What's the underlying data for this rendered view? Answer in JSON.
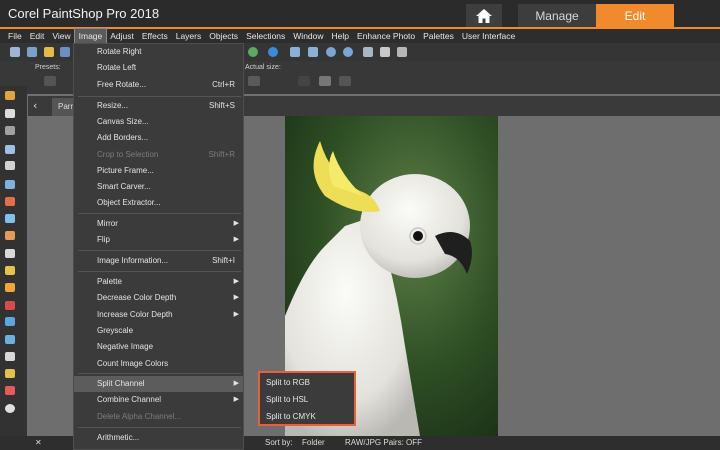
{
  "titlebar": {
    "app_title": "Corel PaintShop Pro 2018",
    "tab_manage": "Manage",
    "tab_edit": "Edit",
    "accent_color": "#f08a2c"
  },
  "menubar": {
    "items": [
      "File",
      "Edit",
      "View",
      "Image",
      "Adjust",
      "Effects",
      "Layers",
      "Objects",
      "Selections",
      "Window",
      "Help",
      "Enhance Photo",
      "Palettes",
      "User Interface"
    ],
    "active": "Image"
  },
  "options": {
    "presets_label": "Presets:",
    "actual_size_label": "Actual size:"
  },
  "doc_tab": {
    "label": "Parr"
  },
  "image_menu": {
    "entries": [
      {
        "label": "Rotate Right",
        "shortcut": "",
        "submenu": false,
        "disabled": false
      },
      {
        "label": "Rotate Left",
        "shortcut": "",
        "submenu": false,
        "disabled": false
      },
      {
        "label": "Free Rotate...",
        "shortcut": "Ctrl+R",
        "submenu": false,
        "disabled": false
      },
      {
        "label": "Resize...",
        "shortcut": "Shift+S",
        "submenu": false,
        "disabled": false
      },
      {
        "label": "Canvas Size...",
        "shortcut": "",
        "submenu": false,
        "disabled": false
      },
      {
        "label": "Add Borders...",
        "shortcut": "",
        "submenu": false,
        "disabled": false
      },
      {
        "label": "Crop to Selection",
        "shortcut": "Shift+R",
        "submenu": false,
        "disabled": true
      },
      {
        "label": "Picture Frame...",
        "shortcut": "",
        "submenu": false,
        "disabled": false
      },
      {
        "label": "Smart Carver...",
        "shortcut": "",
        "submenu": false,
        "disabled": false
      },
      {
        "label": "Object Extractor...",
        "shortcut": "",
        "submenu": false,
        "disabled": false
      },
      {
        "label": "Mirror",
        "shortcut": "",
        "submenu": true,
        "disabled": false
      },
      {
        "label": "Flip",
        "shortcut": "",
        "submenu": true,
        "disabled": false
      },
      {
        "label": "Image Information...",
        "shortcut": "Shift+I",
        "submenu": false,
        "disabled": false
      },
      {
        "label": "Palette",
        "shortcut": "",
        "submenu": true,
        "disabled": false
      },
      {
        "label": "Decrease Color Depth",
        "shortcut": "",
        "submenu": true,
        "disabled": false
      },
      {
        "label": "Increase Color Depth",
        "shortcut": "",
        "submenu": true,
        "disabled": false
      },
      {
        "label": "Greyscale",
        "shortcut": "",
        "submenu": false,
        "disabled": false
      },
      {
        "label": "Negative Image",
        "shortcut": "",
        "submenu": false,
        "disabled": false
      },
      {
        "label": "Count Image Colors",
        "shortcut": "",
        "submenu": false,
        "disabled": false
      },
      {
        "label": "Split Channel",
        "shortcut": "",
        "submenu": true,
        "disabled": false,
        "highlighted": true
      },
      {
        "label": "Combine Channel",
        "shortcut": "",
        "submenu": true,
        "disabled": false
      },
      {
        "label": "Delete Alpha Channel...",
        "shortcut": "",
        "submenu": false,
        "disabled": true
      },
      {
        "label": "Arithmetic...",
        "shortcut": "",
        "submenu": false,
        "disabled": false
      }
    ]
  },
  "split_channel_submenu": {
    "items": [
      "Split to RGB",
      "Split to HSL",
      "Split to CMYK"
    ],
    "highlight_color": "#e8603a"
  },
  "bottombar": {
    "sort_by_label": "Sort by:",
    "sort_value": "Folder",
    "raw_pairs": "RAW/JPG Pairs: OFF"
  }
}
